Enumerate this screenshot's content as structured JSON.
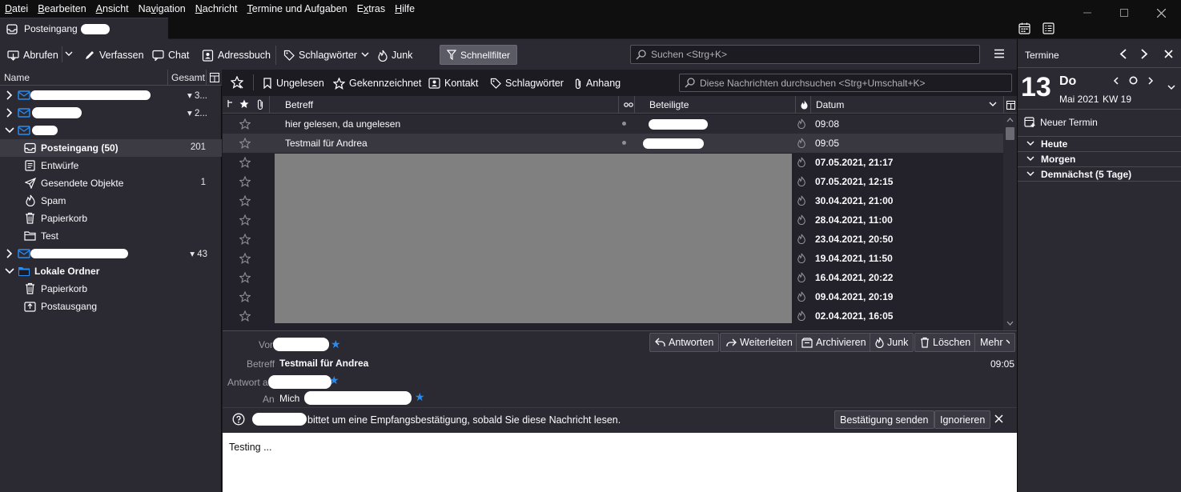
{
  "menu": [
    "Datei",
    "Bearbeiten",
    "Ansicht",
    "Navigation",
    "Nachricht",
    "Termine und Aufgaben",
    "Extras",
    "Hilfe"
  ],
  "menu_accel": [
    "D",
    "B",
    "A",
    "v",
    "N",
    "T",
    "x",
    "H"
  ],
  "tab": {
    "title": "Posteingang"
  },
  "toolbar": {
    "get_messages": "Abrufen",
    "write": "Verfassen",
    "chat": "Chat",
    "address_book": "Adressbuch",
    "tags": "Schlagwörter",
    "junk": "Junk",
    "quick_filter": "Schnellfilter",
    "search_placeholder": "Suchen <Strg+K>"
  },
  "folder_pane": {
    "col_name": "Name",
    "col_total": "Gesamt",
    "accounts": [
      {
        "count": "3..."
      },
      {
        "count": "2..."
      },
      {
        "count": ""
      }
    ],
    "folders": [
      {
        "name": "Posteingang (50)",
        "count": "201",
        "icon": "inbox-icon"
      },
      {
        "name": "Entwürfe",
        "count": "",
        "icon": "drafts-icon"
      },
      {
        "name": "Gesendete Objekte",
        "count": "1",
        "icon": "sent-icon"
      },
      {
        "name": "Spam",
        "count": "",
        "icon": "spam-icon"
      },
      {
        "name": "Papierkorb",
        "count": "",
        "icon": "trash-icon"
      },
      {
        "name": "Test",
        "count": "",
        "icon": "folder-icon"
      }
    ],
    "account4_count": "43",
    "local_folders": {
      "name": "Lokale Ordner",
      "children": [
        {
          "name": "Papierkorb",
          "icon": "trash-icon"
        },
        {
          "name": "Postausgang",
          "icon": "outbox-icon"
        }
      ]
    }
  },
  "quick_filter_bar": {
    "unread": "Ungelesen",
    "starred": "Gekennzeichnet",
    "contact": "Kontakt",
    "tags": "Schlagwörter",
    "attachment": "Anhang",
    "search_placeholder": "Diese Nachrichten durchsuchen <Strg+Umschalt+K>"
  },
  "thread_columns": {
    "subject": "Betreff",
    "correspondents": "Beteiligte",
    "date": "Datum"
  },
  "messages": [
    {
      "subject": "hier gelesen, da ungelesen",
      "date": "09:08",
      "bold": false
    },
    {
      "subject": "Testmail für Andrea",
      "date": "09:05",
      "bold": false,
      "selected": true
    },
    {
      "subject": "",
      "date": "07.05.2021, 21:17",
      "bold": true
    },
    {
      "subject": "",
      "date": "07.05.2021, 12:15",
      "bold": true
    },
    {
      "subject": "",
      "date": "30.04.2021, 21:00",
      "bold": true
    },
    {
      "subject": "",
      "date": "28.04.2021, 11:00",
      "bold": true
    },
    {
      "subject": "",
      "date": "23.04.2021, 20:50",
      "bold": true
    },
    {
      "subject": "",
      "date": "19.04.2021, 11:50",
      "bold": true
    },
    {
      "subject": "",
      "date": "16.04.2021, 20:22",
      "bold": true
    },
    {
      "subject": "",
      "date": "09.04.2021, 20:19",
      "bold": true
    },
    {
      "subject": "",
      "date": "02.04.2021, 16:05",
      "bold": true
    }
  ],
  "message_header": {
    "from_label": "Von",
    "subject_label": "Betreff",
    "subject": "Testmail für Andrea",
    "reply_to_label": "Antwort an",
    "to_label": "An",
    "to_name": "Mich",
    "time": "09:05",
    "buttons": {
      "reply": "Antworten",
      "forward": "Weiterleiten",
      "archive": "Archivieren",
      "junk": "Junk",
      "delete": "Löschen",
      "more": "Mehr"
    }
  },
  "notification": {
    "text": "bittet um eine Empfangsbestätigung, sobald Sie diese Nachricht lesen.",
    "send_button": "Bestätigung senden",
    "ignore_button": "Ignorieren"
  },
  "message_body": {
    "text": "Testing ..."
  },
  "today_pane": {
    "title": "Termine",
    "day_number": "13",
    "weekday": "Do",
    "month_year": "Mai 2021",
    "week": "KW 19",
    "new_event": "Neuer Termin",
    "sections": [
      "Heute",
      "Morgen",
      "Demnächst (5 Tage)"
    ]
  }
}
